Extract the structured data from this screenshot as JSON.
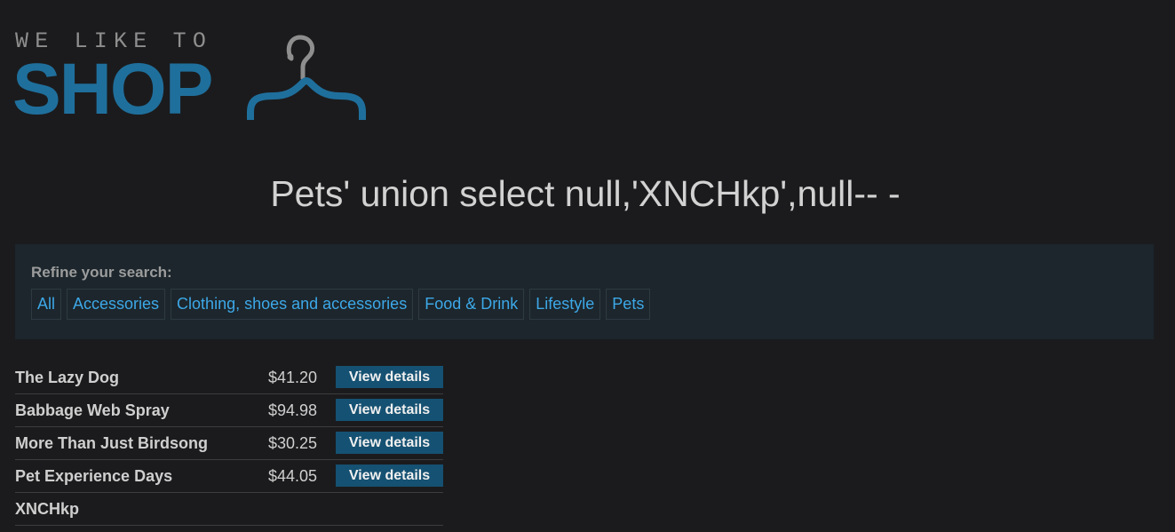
{
  "logo": {
    "tagline": "WE LIKE TO",
    "word": "SHOP"
  },
  "title": "Pets' union select null,'XNCHkp',null-- -",
  "filters": {
    "heading": "Refine your search:",
    "categories": [
      "All",
      "Accessories",
      "Clothing, shoes and accessories",
      "Food & Drink",
      "Lifestyle",
      "Pets"
    ]
  },
  "products": [
    {
      "name": "The Lazy Dog",
      "price": "$41.20",
      "action": "View details"
    },
    {
      "name": "Babbage Web Spray",
      "price": "$94.98",
      "action": "View details"
    },
    {
      "name": "More Than Just Birdsong",
      "price": "$30.25",
      "action": "View details"
    },
    {
      "name": "Pet Experience Days",
      "price": "$44.05",
      "action": "View details"
    },
    {
      "name": "XNCHkp",
      "price": "",
      "action": ""
    }
  ],
  "colors": {
    "background": "#1b1b1d",
    "brand_blue": "#1f6f9c",
    "link_blue": "#3da8e8",
    "button_blue": "#155172",
    "panel": "#1c262c"
  }
}
